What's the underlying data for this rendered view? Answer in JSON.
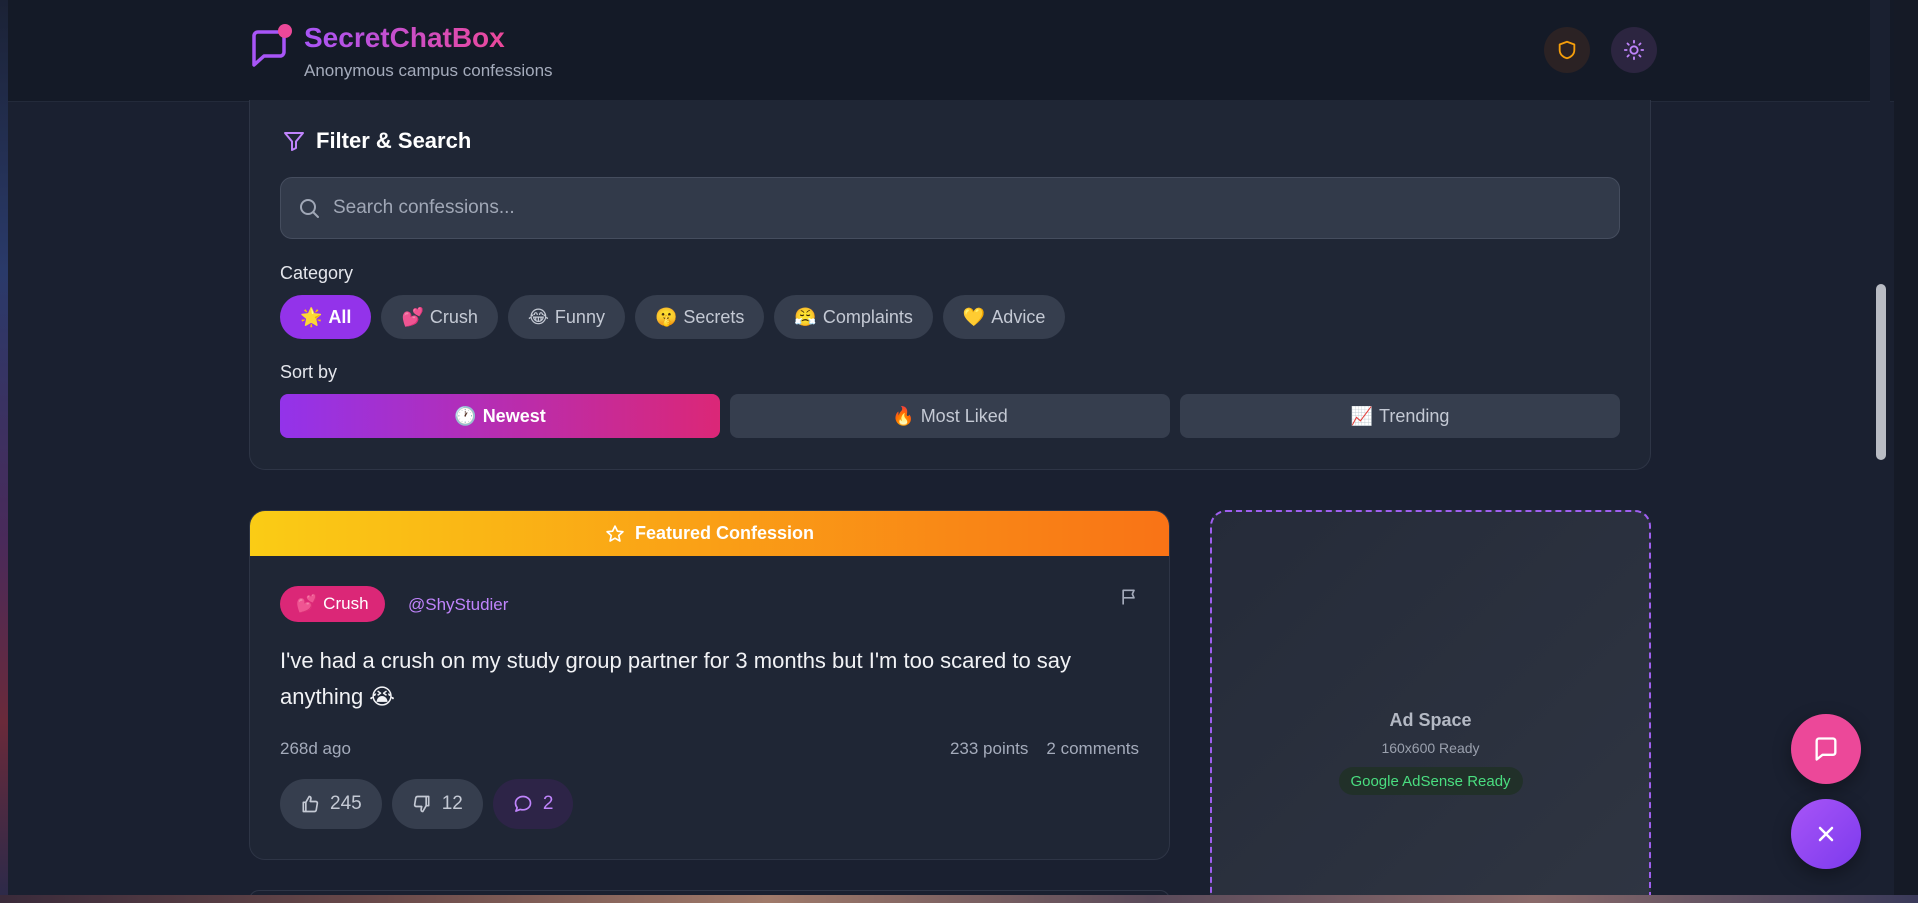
{
  "header": {
    "brand": "SecretChatBox",
    "tagline": "Anonymous campus confessions",
    "icons": {
      "logo": "chat-bubble-icon",
      "shield": "shield-icon",
      "theme": "sun-icon"
    }
  },
  "filter": {
    "title": "Filter & Search",
    "search_placeholder": "Search confessions...",
    "category_label": "Category",
    "categories": [
      {
        "emoji": "🌟",
        "label": "All",
        "active": true
      },
      {
        "emoji": "💕",
        "label": "Crush",
        "active": false
      },
      {
        "emoji": "😂",
        "label": "Funny",
        "active": false
      },
      {
        "emoji": "🤫",
        "label": "Secrets",
        "active": false
      },
      {
        "emoji": "😤",
        "label": "Complaints",
        "active": false
      },
      {
        "emoji": "💛",
        "label": "Advice",
        "active": false
      }
    ],
    "sort_label": "Sort by",
    "sort_options": [
      {
        "emoji": "🕐",
        "label": "Newest",
        "active": true
      },
      {
        "emoji": "🔥",
        "label": "Most Liked",
        "active": false
      },
      {
        "emoji": "📈",
        "label": "Trending",
        "active": false
      }
    ]
  },
  "featured_post": {
    "banner": "Featured Confession",
    "category_emoji": "💕",
    "category": "Crush",
    "author": "@ShyStudier",
    "text": "I've had a crush on my study group partner for 3 months but I'm too scared to say anything 😭",
    "time_ago": "268d ago",
    "points": "233 points",
    "comments_text": "2 comments",
    "likes": "245",
    "dislikes": "12",
    "comments": "2"
  },
  "ad": {
    "title": "Ad Space",
    "size": "160x600 Ready",
    "status": "Google AdSense Ready"
  },
  "colors": {
    "accent_purple": "#9333ea",
    "accent_pink": "#db2777",
    "featured_start": "#facc15",
    "featured_end": "#f97316"
  }
}
